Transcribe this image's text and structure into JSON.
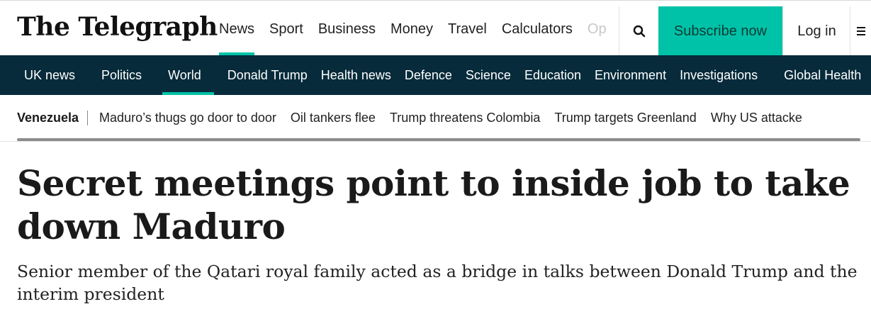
{
  "header": {
    "logo_text": "The Telegraph",
    "nav": [
      "News",
      "Sport",
      "Business",
      "Money",
      "Travel",
      "Calculators",
      "Op"
    ],
    "active_nav": "News",
    "search_icon": "search-icon",
    "subscribe_label": "Subscribe now",
    "login_label": "Log in",
    "menu_icon": "hamburger-menu-icon"
  },
  "section_nav": [
    "UK news",
    "Politics",
    "World",
    "Donald Trump",
    "Health news",
    "Defence",
    "Science",
    "Education",
    "Environment",
    "Investigations",
    "Global Health"
  ],
  "active_section": "World",
  "topic_bar": {
    "tag": "Venezuela",
    "links": [
      "Maduro’s thugs go door to door",
      "Oil tankers flee",
      "Trump threatens Colombia",
      "Trump targets Greenland",
      "Why US attacke"
    ]
  },
  "article": {
    "headline": "Secret meetings point to inside job to take down Maduro",
    "standfirst": "Senior member of the Qatari royal family acted as a bridge in talks between Donald Trump and the interim president"
  },
  "colors": {
    "accent": "#00c2a8",
    "section_nav_bg": "#072b3a"
  }
}
